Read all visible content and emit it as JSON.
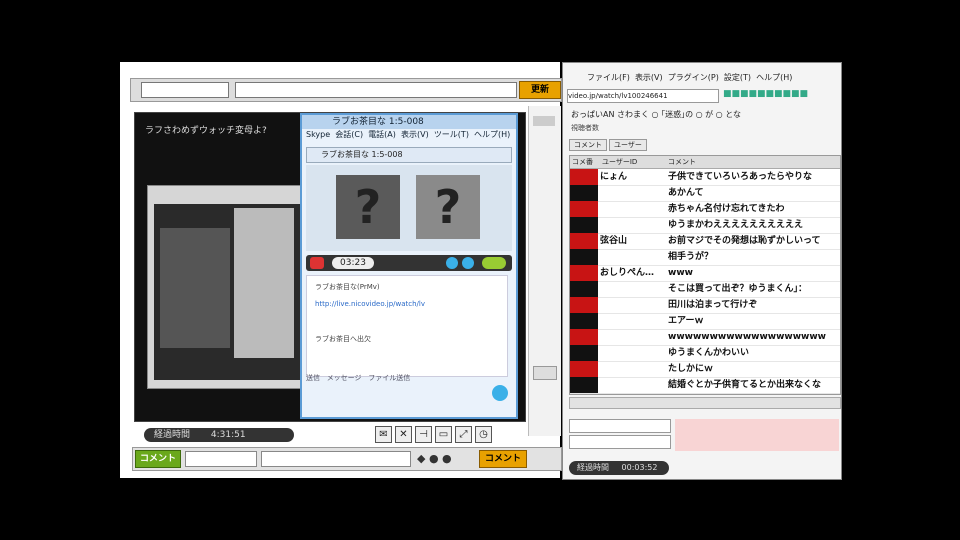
{
  "browser": {
    "orange_button_top": "更新",
    "player_title": "ラフさわめずウォッチ変母よ?",
    "elapsed_label": "経過時間",
    "elapsed_value": "4:31:51",
    "bottom_green_button": "コメント",
    "bottom_orange_button": "コメント"
  },
  "skype": {
    "title": "ラブお茶目な 1:5-008",
    "menu": [
      "Skype",
      "会話(C)",
      "電話(A)",
      "表示(V)",
      "ツール(T)",
      "ヘルプ(H)"
    ],
    "call_name": "ラブお茶目な 1:5-008",
    "call_time": "03:23",
    "chat_lines": [
      "ラブお茶目な(PrMv)",
      "ラブお茶目へ出欠"
    ],
    "link_text": "http://live.nicovideo.jp/watch/lv",
    "bottom_items": [
      "送信",
      "メッセージ",
      "ファイル送信"
    ]
  },
  "viewer": {
    "menu": [
      "ファイル(F)",
      "表示(V)",
      "プラグイン(P)",
      "設定(T)",
      "ヘルプ(H)"
    ],
    "url": "video.jp/watch/lv100246641",
    "info_title": "おっぱいAN さわまく ○ ｢迷惑｣の ○ が ○ とな",
    "info_sub": "視聴者数",
    "tabs": [
      "コメント",
      "ユーザー"
    ],
    "columns": [
      "コメ番",
      "ユーザーID",
      "コメント"
    ],
    "comments": [
      {
        "user": "にょん",
        "text": "子供できていろいろあったらやりな"
      },
      {
        "user": "",
        "text": "あかんて"
      },
      {
        "user": "",
        "text": "赤ちゃん名付け忘れてきたわ"
      },
      {
        "user": "",
        "text": "ゆうまかわええええええええええ"
      },
      {
        "user": "弦谷山",
        "text": "お前マジでその発想は恥ずかしいって"
      },
      {
        "user": "",
        "text": "相手うが？"
      },
      {
        "user": "おしりぺん…",
        "text": "www"
      },
      {
        "user": "",
        "text": "そこは買って出ぞ？ゆうまくん」："
      },
      {
        "user": "",
        "text": "田川は泊まって行けぞ"
      },
      {
        "user": "",
        "text": "エアーｗ"
      },
      {
        "user": "",
        "text": "wwwwwwwwwwwwwwwwwww"
      },
      {
        "user": "",
        "text": "ゆうまくんかわいい"
      },
      {
        "user": "",
        "text": "たしかにｗ"
      },
      {
        "user": "",
        "text": "結婚ぐとか子供育てるとか出来なくな"
      }
    ],
    "elapsed_label": "経過時間",
    "elapsed_value": "00:03:52"
  },
  "colors": {
    "accent_red": "#c81414",
    "row_black": "#111111"
  }
}
